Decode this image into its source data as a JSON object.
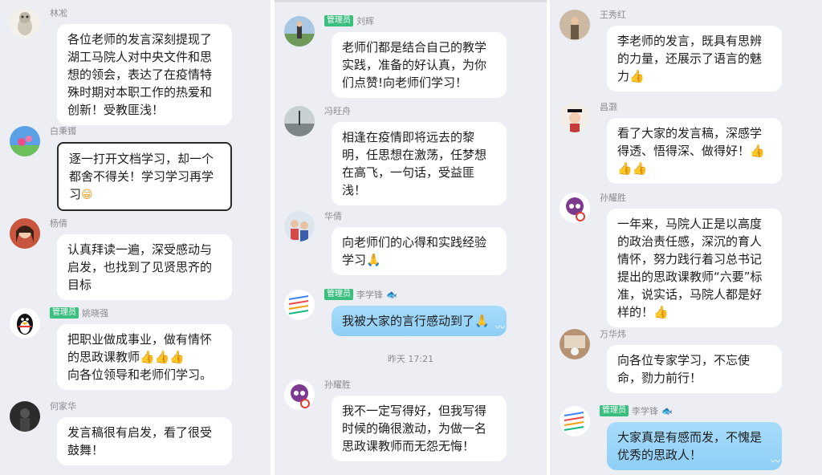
{
  "columns": [
    {
      "messages": [
        {
          "name": "林凇",
          "badge": "",
          "text": "各位老师的发言深刻提现了湖工马院人对中央文件和思想的领会，表达了在疫情特殊时期对本职工作的热爱和创新！受教匪浅！",
          "avatar": "cat-avatar-icon",
          "avatar_color": "#d9d2c6"
        },
        {
          "name": "白秉镯",
          "badge": "",
          "text": "逐一打开文档学习，却一个都舍不得关！学习学习再学习",
          "emoji": "😁",
          "avatar": "flower-avatar-icon",
          "avatar_color": "#5aa0e6"
        },
        {
          "name": "杨倩",
          "badge": "",
          "text": "认真拜读一遍，深受感动与启发，也找到了见贤思齐的目标",
          "avatar": "person-avatar-icon",
          "avatar_color": "#c8553d"
        },
        {
          "name": "姚晓强",
          "badge": "管理员",
          "text": "把职业做成事业，做有情怀的思政课教师👍👍👍\n向各位领导和老师们学习。",
          "avatar": "penguin-avatar-icon",
          "avatar_color": "#ffffff"
        },
        {
          "name": "何家华",
          "badge": "",
          "text": "发言稿很有启发，看了很受鼓舞！",
          "avatar": "dark-person-avatar-icon",
          "avatar_color": "#2b2b2b"
        }
      ]
    },
    {
      "messages": [
        {
          "name": "刘辉",
          "badge": "管理员",
          "text": "老师们都是结合自己的教学实践，准备的好认真，为你们点赞!向老师们学习！",
          "avatar": "outdoor-person-avatar-icon",
          "avatar_color": "#6f9a5b"
        },
        {
          "name": "冯旺舟",
          "badge": "",
          "text": "相逢在疫情即将远去的黎明，任思想在激荡，任梦想在高飞，一句话，受益匪浅！",
          "avatar": "road-avatar-icon",
          "avatar_color": "#9aa3a8"
        },
        {
          "name": "华倩",
          "badge": "",
          "text": "向老师们的心得和实践经验学习🙏",
          "avatar": "family-avatar-icon",
          "avatar_color": "#b7c8dc"
        },
        {
          "name": "李学锋",
          "badge": "管理员",
          "text": "我被大家的言行感动到了🙏",
          "avatar": "lines-avatar-icon",
          "avatar_color": "#ffffff",
          "style": "blue"
        },
        {
          "name": "孙耀胜",
          "badge": "",
          "text": "我不一定写得好，但我写得时候的确很激动，为做一名思政课教师而无怨无悔！",
          "avatar": "cartoon-avatar-icon",
          "avatar_color": "#7d3b8f"
        }
      ],
      "timestamp": "昨天 17:21"
    },
    {
      "messages": [
        {
          "name": "王秀红",
          "badge": "",
          "text": "李老师的发言，既具有思辨的力量，还展示了语言的魅力👍",
          "avatar": "woman-avatar-icon",
          "avatar_color": "#8b7d6b"
        },
        {
          "name": "昌灏",
          "badge": "",
          "text": "看了大家的发言稿，深感学得透、悟得深、做得好！👍👍👍",
          "avatar": "graduate-avatar-icon",
          "avatar_color": "#c43b3b"
        },
        {
          "name": "孙耀胜",
          "badge": "",
          "text": "一年来，马院人正是以高度的政治责任感，深沉的育人情怀，努力践行着习总书记提出的思政课教师“六要”标准，说实话，马院人都是好样的！👍",
          "avatar": "cartoon-avatar-icon",
          "avatar_color": "#7d3b8f"
        },
        {
          "name": "万华炜",
          "badge": "",
          "text": "向各位专家学习，不忘使命，勠力前行！",
          "avatar": "room-avatar-icon",
          "avatar_color": "#8a6a4f"
        },
        {
          "name": "李学锋",
          "badge": "管理员",
          "text": "大家真是有感而发，不愧是优秀的思政人！",
          "avatar": "lines-avatar-icon",
          "avatar_color": "#ffffff",
          "style": "blue"
        }
      ]
    }
  ]
}
